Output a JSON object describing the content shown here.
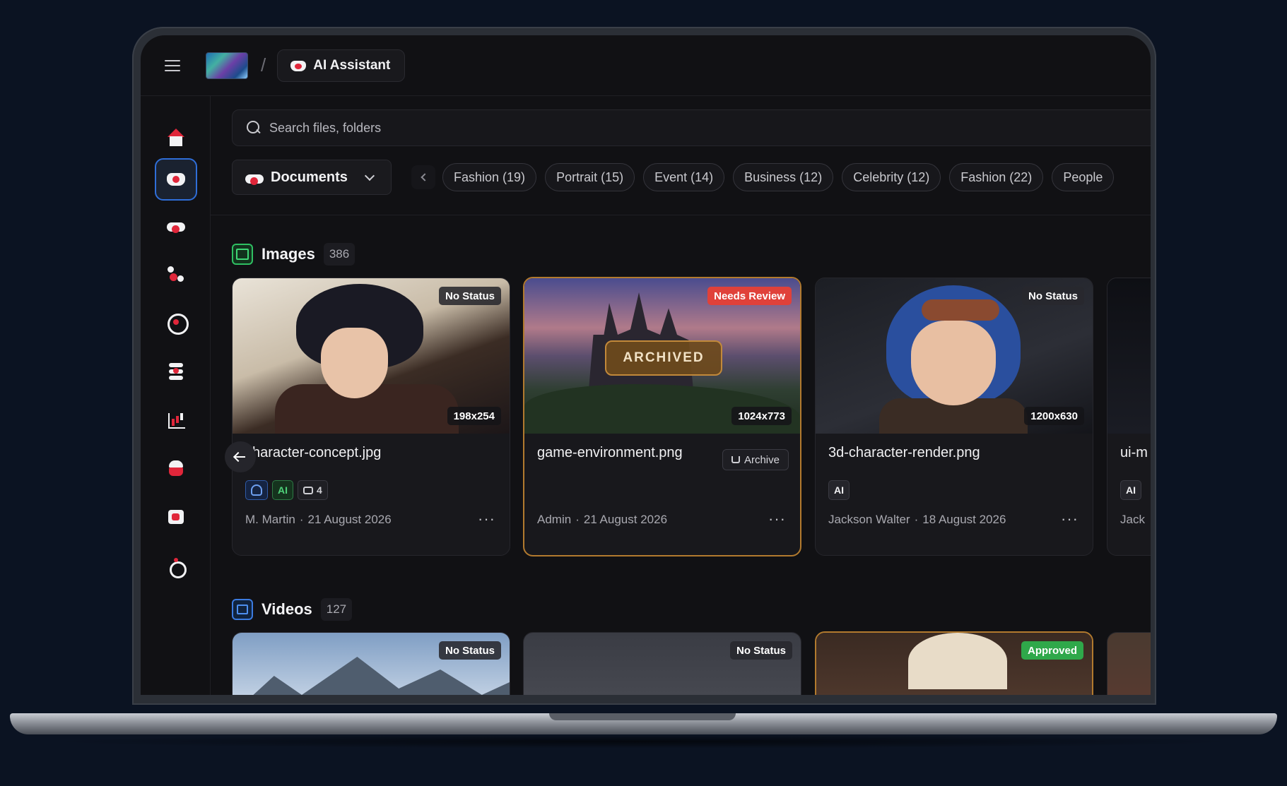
{
  "topbar": {
    "title": "AI Assistant"
  },
  "search": {
    "placeholder": "Search files, folders"
  },
  "filters": {
    "dropdown_label": "Documents",
    "chips": [
      "Fashion (19)",
      "Portrait (15)",
      "Event (14)",
      "Business (12)",
      "Celebrity (12)",
      "Fashion (22)",
      "People"
    ]
  },
  "sidebar": {
    "items": [
      "home-icon",
      "gamepad-icon",
      "cloud-icon",
      "flow-icon",
      "globe-icon",
      "stack-icon",
      "chart-icon",
      "team-icon",
      "film-icon",
      "ring-icon"
    ],
    "active_index": 1
  },
  "images": {
    "title": "Images",
    "count": "386",
    "cards": [
      {
        "filename": "character-concept.jpg",
        "status": "No Status",
        "dimensions": "198x254",
        "tags": [
          "user",
          "AI"
        ],
        "comments": "4",
        "author": "M. Martin",
        "date": "21 August 2026"
      },
      {
        "filename": "game-environment.png",
        "status": "Needs Review",
        "dimensions": "1024x773",
        "overlay": "ARCHIVED",
        "action": "Archive",
        "author": "Admin",
        "date": "21 August 2026"
      },
      {
        "filename": "3d-character-render.png",
        "status": "No Status",
        "dimensions": "1200x630",
        "tags": [
          "AI"
        ],
        "author": "Jackson Walter",
        "date": "18 August 2026"
      },
      {
        "filename": "ui-m",
        "tags": [
          "AI"
        ],
        "author": "Jack"
      }
    ]
  },
  "videos": {
    "title": "Videos",
    "count": "127",
    "cards": [
      {
        "status": "No Status"
      },
      {
        "status": "No Status"
      },
      {
        "status": "Approved"
      }
    ]
  },
  "meta_separator": "·",
  "more_glyph": "···",
  "colors": {
    "accent_red": "#e0263a",
    "active_blue": "#2f6ed8",
    "review_red": "#e0413a",
    "approved_green": "#2fa84a",
    "archived_gold": "#b27a2e"
  }
}
